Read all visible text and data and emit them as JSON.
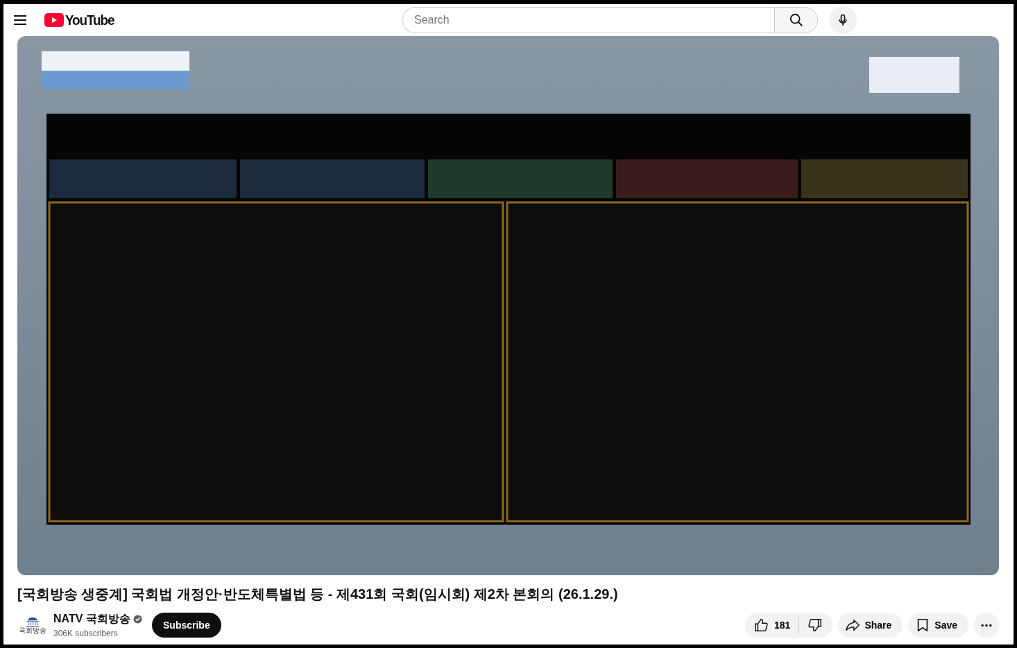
{
  "header": {
    "logo": "YouTube",
    "search": {
      "placeholder": "Search"
    }
  },
  "title": "[국회방송 생중계] 국회법 개정안·반도체특별법 등 - 제431회 국회(임시회) 제2차 본회의 (26.1.29.)",
  "channel": {
    "avatar_caption": "국회방송",
    "name": "NATV 국회방송",
    "verified": true,
    "subscribers": "306K subscribers",
    "subscribe": "Subscribe"
  },
  "actions": {
    "likes": "181",
    "share": "Share",
    "save": "Save"
  }
}
